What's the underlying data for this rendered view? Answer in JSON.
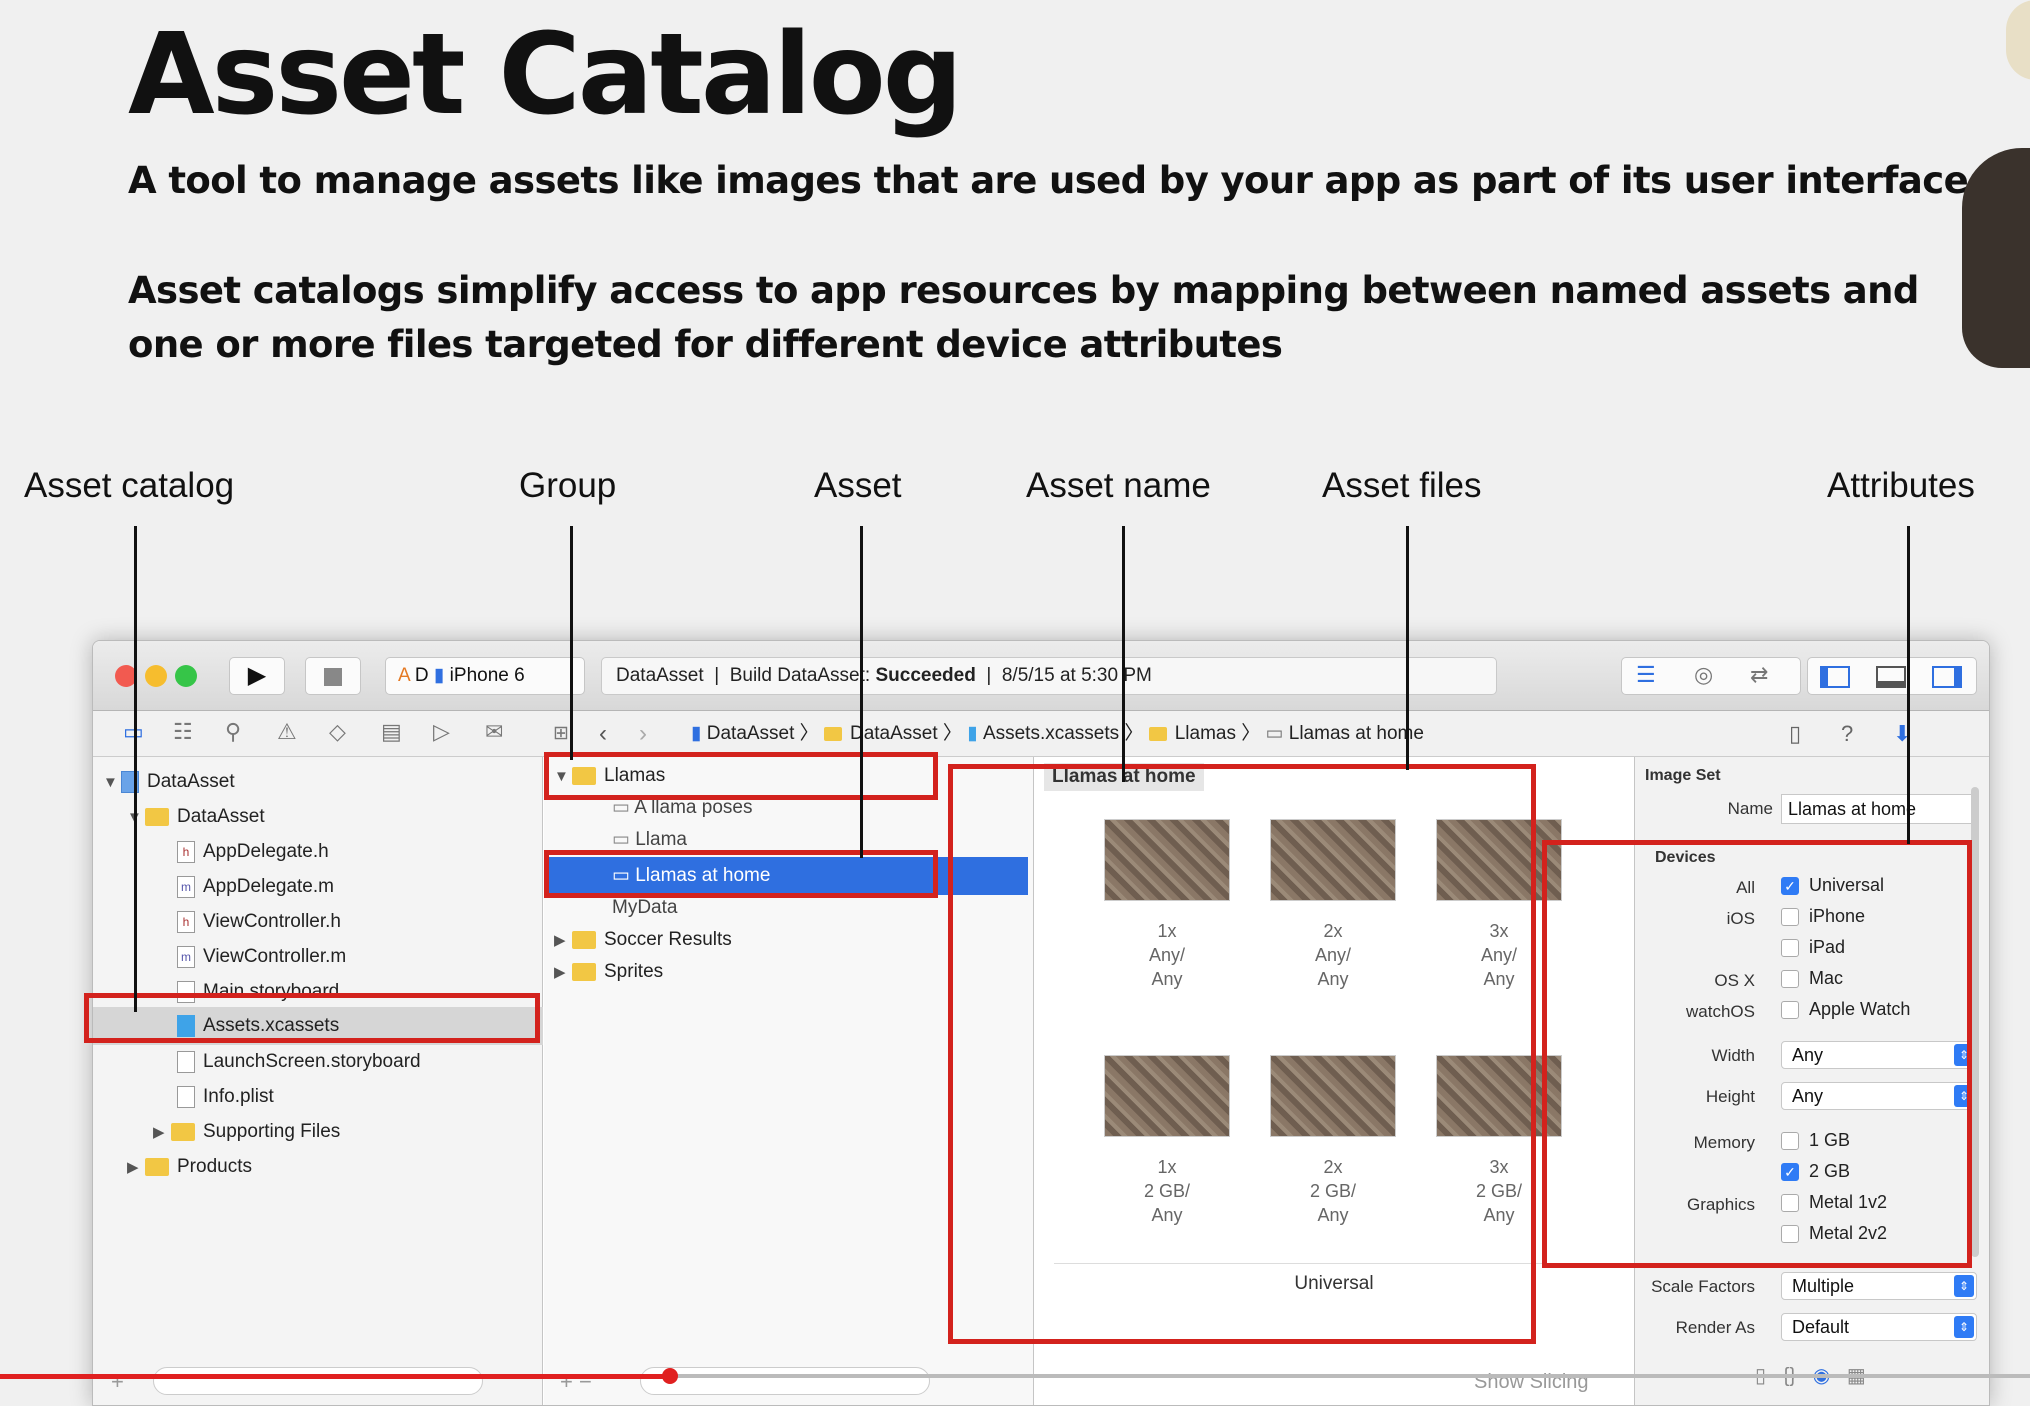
{
  "slide": {
    "title": "Asset Catalog",
    "subtitle1": "A tool to manage assets like images that are used by your app as part of its user interface (UI).",
    "subtitle2_line1": "Asset catalogs simplify access to app resources by mapping between named assets and",
    "subtitle2_line2": "one or more files targeted for different device attributes",
    "callouts": [
      "Asset catalog",
      "Group",
      "Asset",
      "Asset name",
      "Asset files",
      "Attributes"
    ]
  },
  "toolbar": {
    "scheme_app": "D",
    "scheme_device": "iPhone 6",
    "activity_project": "DataAsset",
    "activity_build": "Build DataAsset:",
    "activity_status": "Succeeded",
    "activity_time": "8/5/15 at 5:30 PM"
  },
  "navigator": {
    "items": [
      {
        "label": "DataAsset",
        "kind": "project"
      },
      {
        "label": "DataAsset",
        "kind": "folder"
      },
      {
        "label": "AppDelegate.h",
        "kind": "h"
      },
      {
        "label": "AppDelegate.m",
        "kind": "m"
      },
      {
        "label": "ViewController.h",
        "kind": "h"
      },
      {
        "label": "ViewController.m",
        "kind": "m"
      },
      {
        "label": "Main.storyboard",
        "kind": "sb"
      },
      {
        "label": "Assets.xcassets",
        "kind": "assets"
      },
      {
        "label": "LaunchScreen.storyboard",
        "kind": "sb"
      },
      {
        "label": "Info.plist",
        "kind": "plist"
      },
      {
        "label": "Supporting Files",
        "kind": "folder"
      },
      {
        "label": "Products",
        "kind": "folder"
      }
    ]
  },
  "jumpbar": [
    "DataAsset",
    "DataAsset",
    "Assets.xcassets",
    "Llamas",
    "Llamas at home"
  ],
  "setlist": {
    "items": [
      "Llamas",
      "A llama poses",
      "Llama",
      "Llamas at home",
      "MyData",
      "Soccer Results",
      "Sprites"
    ]
  },
  "editor": {
    "asset_name": "Llamas at home",
    "row1_caps": [
      [
        "1x",
        "Any/",
        "Any"
      ],
      [
        "2x",
        "Any/",
        "Any"
      ],
      [
        "3x",
        "Any/",
        "Any"
      ]
    ],
    "row2_caps": [
      [
        "1x",
        "2 GB/",
        "Any"
      ],
      [
        "2x",
        "2 GB/",
        "Any"
      ],
      [
        "3x",
        "2 GB/",
        "Any"
      ]
    ],
    "footer": "Universal",
    "show_slicing": "Show Slicing"
  },
  "inspector": {
    "section": "Image Set",
    "name_label": "Name",
    "name_value": "Llamas at home",
    "devices_label": "Devices",
    "device_rows": [
      {
        "label": "All",
        "value": "Universal",
        "checked": true
      },
      {
        "label": "iOS",
        "value": "iPhone",
        "checked": false
      },
      {
        "label": "",
        "value": "iPad",
        "checked": false
      },
      {
        "label": "OS X",
        "value": "Mac",
        "checked": false
      },
      {
        "label": "watchOS",
        "value": "Apple Watch",
        "checked": false
      }
    ],
    "width_label": "Width",
    "width_value": "Any",
    "height_label": "Height",
    "height_value": "Any",
    "memory_rows": [
      {
        "label": "Memory",
        "value": "1 GB",
        "checked": false
      },
      {
        "label": "",
        "value": "2 GB",
        "checked": true
      }
    ],
    "graphics_rows": [
      {
        "label": "Graphics",
        "value": "Metal 1v2",
        "checked": false
      },
      {
        "label": "",
        "value": "Metal 2v2",
        "checked": false
      }
    ],
    "scale_label": "Scale Factors",
    "scale_value": "Multiple",
    "render_label": "Render As",
    "render_value": "Default"
  },
  "video": {
    "progress": 0.33
  },
  "colors": {
    "highlight": "#d3221d",
    "selection": "#2f6fe0",
    "folder": "#f2c744"
  }
}
